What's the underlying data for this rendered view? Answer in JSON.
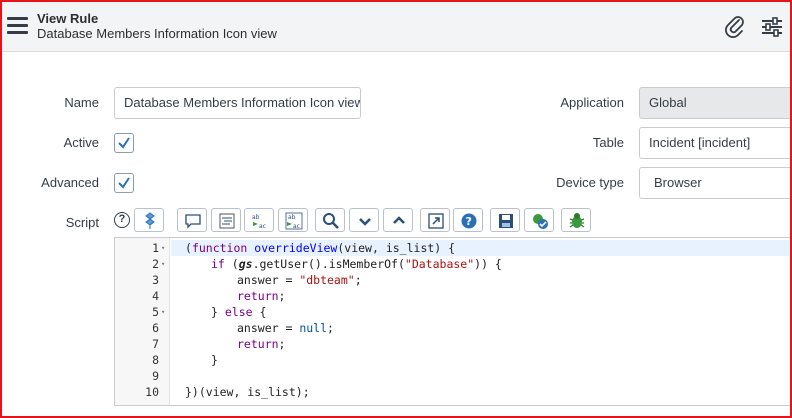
{
  "header": {
    "title": "View Rule",
    "subtitle": "Database Members Information Icon view"
  },
  "form": {
    "name_label": "Name",
    "name_value": "Database Members Information Icon view",
    "active_label": "Active",
    "active_checked": true,
    "advanced_label": "Advanced",
    "advanced_checked": true,
    "script_label": "Script",
    "application_label": "Application",
    "application_value": "Global",
    "table_label": "Table",
    "table_value": "Incident [incident]",
    "device_label": "Device type",
    "device_value": "Browser"
  },
  "toolbar": {
    "help": "?",
    "buttons": [
      "script-debugger",
      "comment",
      "format",
      "replace",
      "replace-all",
      "search",
      "fold-all",
      "unfold-all",
      "fullscreen",
      "help",
      "save",
      "syntax-check",
      "debug"
    ]
  },
  "editor": {
    "lines": [
      {
        "n": "1",
        "fold": "▾"
      },
      {
        "n": "2",
        "fold": "▾"
      },
      {
        "n": "3",
        "fold": ""
      },
      {
        "n": "4",
        "fold": ""
      },
      {
        "n": "5",
        "fold": "▾"
      },
      {
        "n": "6",
        "fold": ""
      },
      {
        "n": "7",
        "fold": ""
      },
      {
        "n": "8",
        "fold": ""
      },
      {
        "n": "9",
        "fold": ""
      },
      {
        "n": "10",
        "fold": ""
      }
    ],
    "code": {
      "l1_open": "(",
      "l1_kw": "function",
      "l1_fn": "overrideView",
      "l1_args": "(view, is_list) {",
      "l2_kw": "if",
      "l2_a": " (",
      "l2_gs": "gs",
      "l2_b": ".getUser().isMemberOf(",
      "l2_str": "\"Database\"",
      "l2_c": ")) {",
      "l3_a": "answer = ",
      "l3_str": "\"dbteam\"",
      "l3_b": ";",
      "l4_kw": "return",
      "l4_b": ";",
      "l5_a": "} ",
      "l5_kw": "else",
      "l5_b": " {",
      "l6_a": "answer = ",
      "l6_kw": "null",
      "l6_b": ";",
      "l7_kw": "return",
      "l7_b": ";",
      "l8": "}",
      "l10": "})(view, is_list);"
    }
  }
}
